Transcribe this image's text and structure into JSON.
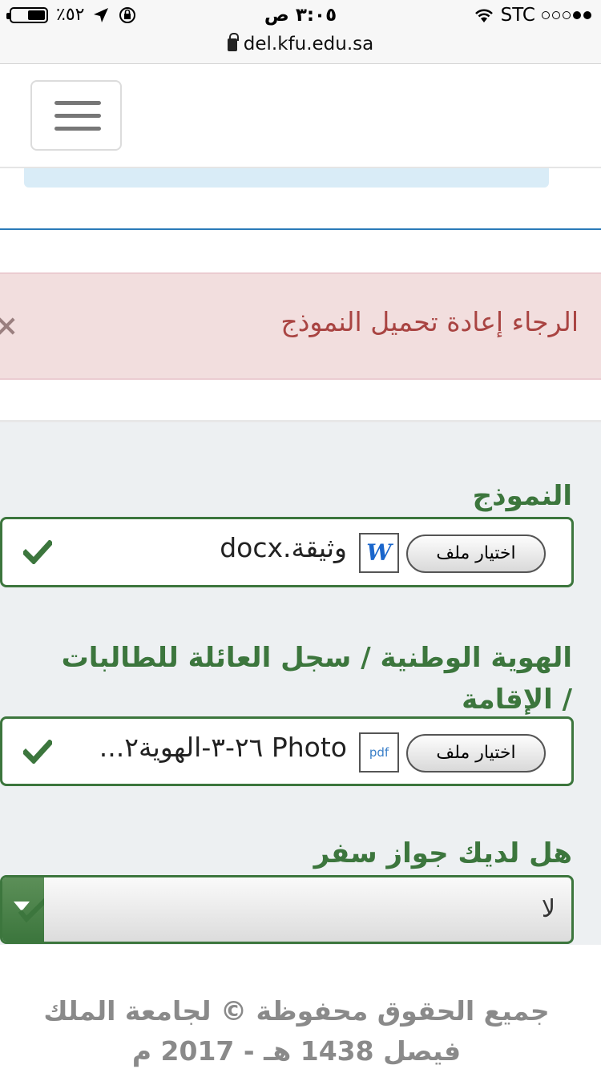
{
  "status_bar": {
    "carrier": "STC",
    "time": "٣:٠٥ ص",
    "battery": "٪٥٢",
    "battery_level": 0.52
  },
  "browser": {
    "url": "del.kfu.edu.sa"
  },
  "alert": {
    "message": "الرجاء إعادة تحميل النموذج"
  },
  "form": {
    "fields": [
      {
        "label": "النموذج",
        "button_label": "اختيار ملف",
        "file_type": "docx",
        "file_icon_text": "W",
        "file_name": "وثيقة.docx",
        "status": "check-icon"
      },
      {
        "label": "الهوية الوطنية / سجل العائلة للطالبات / الإقامة",
        "button_label": "اختيار ملف",
        "file_type": "pdf",
        "file_icon_text": "pdf",
        "file_name": "Photo ٢٦-٣-الهوية٢...",
        "status": "check-icon"
      }
    ],
    "passport": {
      "label": "هل لديك جواز سفر",
      "value": "لا"
    }
  },
  "footer": {
    "text": "جميع الحقوق محفوظة © لجامعة الملك فيصل 1438 هـ - 2017 م"
  },
  "colors": {
    "success": "#3c763d",
    "alert_bg": "#f2dede",
    "alert_text": "#a94442",
    "form_bg": "#edf0f2"
  }
}
